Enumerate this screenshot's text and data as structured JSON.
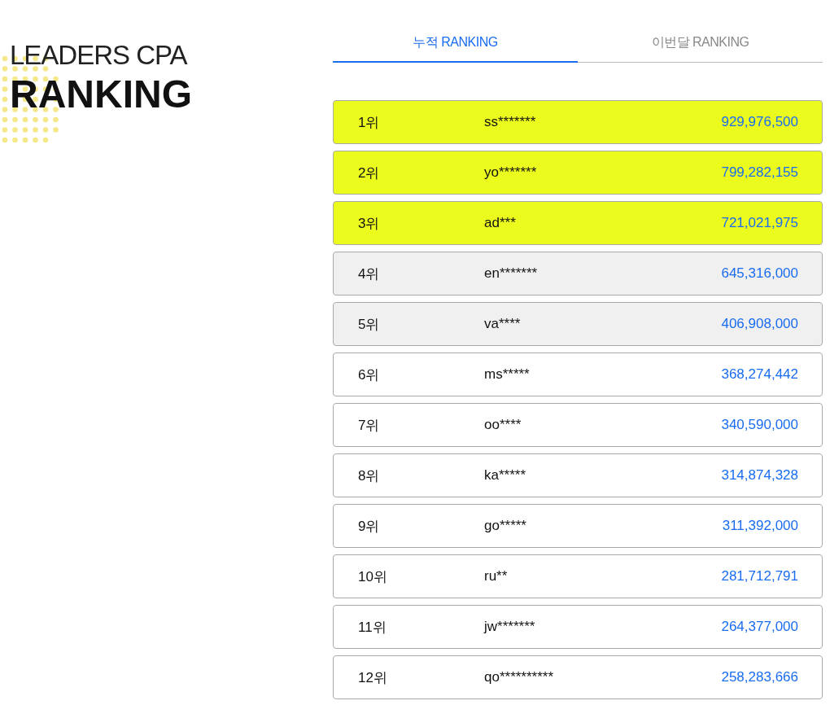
{
  "heading": {
    "subtitle": "LEADERS CPA",
    "title": "RANKING"
  },
  "tabs": [
    {
      "label": "누적 RANKING",
      "selected": true
    },
    {
      "label": "이번달 RANKING",
      "selected": false
    }
  ],
  "rows": [
    {
      "kind": "top",
      "rank": "1위",
      "user": "ss*******",
      "amount": "929,976,500"
    },
    {
      "kind": "top",
      "rank": "2위",
      "user": "yo*******",
      "amount": "799,282,155"
    },
    {
      "kind": "top",
      "rank": "3위",
      "user": "ad***",
      "amount": "721,021,975"
    },
    {
      "kind": "upper",
      "rank": "4위",
      "user": "en*******",
      "amount": "645,316,000"
    },
    {
      "kind": "upper",
      "rank": "5위",
      "user": "va****",
      "amount": "406,908,000"
    },
    {
      "kind": "normal",
      "rank": "6위",
      "user": "ms*****",
      "amount": "368,274,442"
    },
    {
      "kind": "normal",
      "rank": "7위",
      "user": "oo****",
      "amount": "340,590,000"
    },
    {
      "kind": "normal",
      "rank": "8위",
      "user": "ka*****",
      "amount": "314,874,328"
    },
    {
      "kind": "normal",
      "rank": "9위",
      "user": "go*****",
      "amount": "311,392,000"
    },
    {
      "kind": "normal",
      "rank": "10위",
      "user": "ru**",
      "amount": "281,712,791"
    },
    {
      "kind": "normal",
      "rank": "11위",
      "user": "jw*******",
      "amount": "264,377,000"
    },
    {
      "kind": "normal",
      "rank": "12위",
      "user": "qo**********",
      "amount": "258,283,666"
    }
  ]
}
